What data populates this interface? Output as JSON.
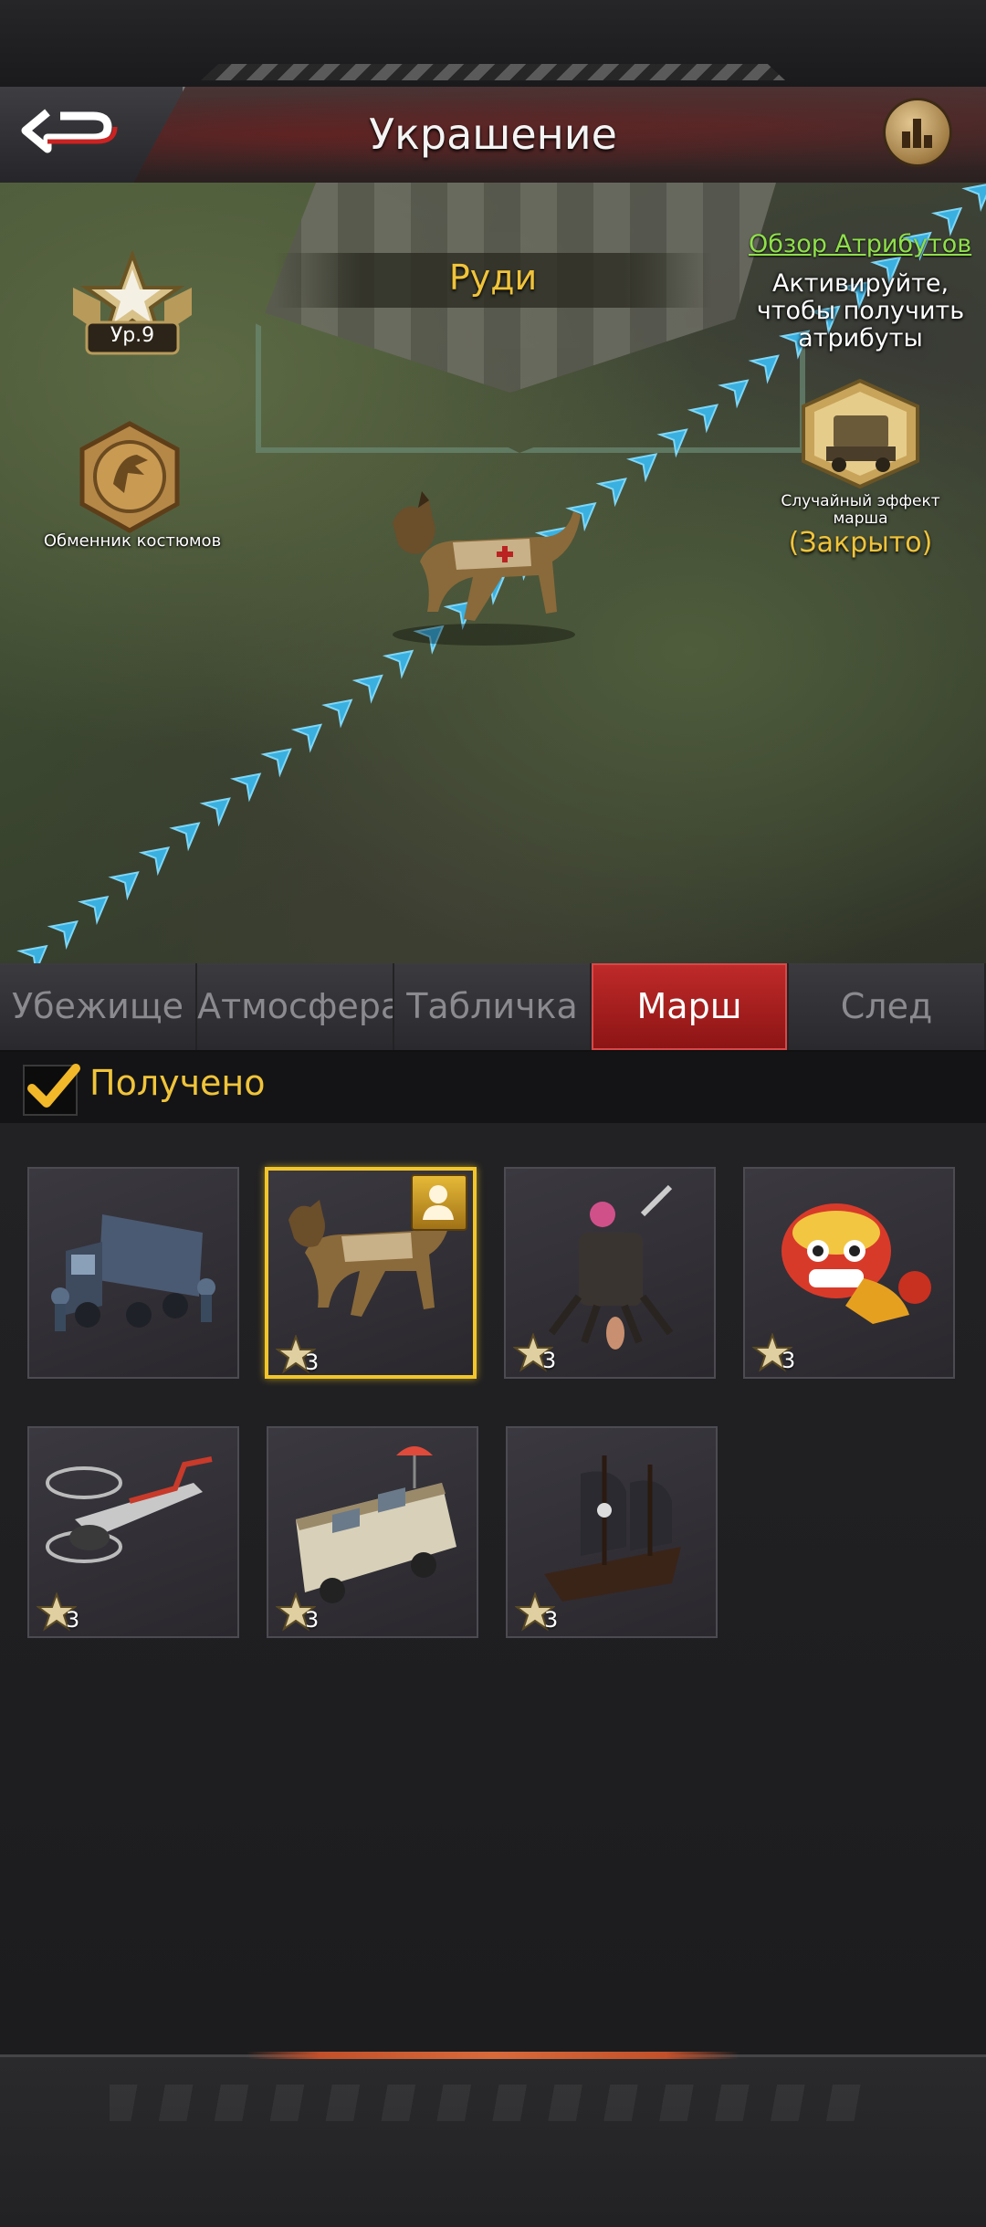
{
  "header": {
    "title": "Украшение"
  },
  "scene": {
    "decoration_name": "Руди",
    "level_label": "Ур.9",
    "costume_exchange_label": "Обменник костюмов",
    "attributes_link": "Обзор Атрибутов",
    "attributes_hint": "Активируйте, чтобы получить атрибуты",
    "march_effect_label": "Случайный эффект марша",
    "march_effect_status": "(Закрыто)"
  },
  "tabs": [
    {
      "label": "Убежище",
      "active": false
    },
    {
      "label": "Атмосфера",
      "active": false
    },
    {
      "label": "Табличка",
      "active": false
    },
    {
      "label": "Марш",
      "active": true
    },
    {
      "label": "След",
      "active": false
    }
  ],
  "filter": {
    "label": "Получено",
    "checked": true
  },
  "items": [
    {
      "name": "military-truck",
      "stars": null,
      "selected": false
    },
    {
      "name": "dog-rudy",
      "stars": "3",
      "selected": true,
      "in_use": true
    },
    {
      "name": "spider-mech",
      "stars": "3",
      "selected": false
    },
    {
      "name": "lion-dance",
      "stars": "3",
      "selected": false
    },
    {
      "name": "helicopter",
      "stars": "3",
      "selected": false
    },
    {
      "name": "camper-van",
      "stars": "3",
      "selected": false
    },
    {
      "name": "pirate-ship",
      "stars": "3",
      "selected": false
    }
  ],
  "colors": {
    "accent_gold": "#f0c43a",
    "link_green": "#8fe04a",
    "active_tab": "#c02a2a",
    "selected_border": "#f2c62a"
  }
}
